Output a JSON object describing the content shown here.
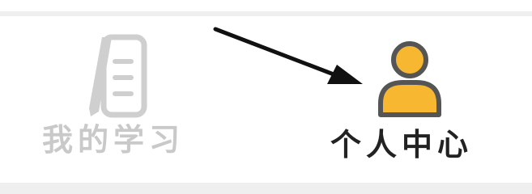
{
  "tabbar": {
    "tabs": [
      {
        "label": "我的学习",
        "icon": "document-pencil-icon",
        "state": "inactive"
      },
      {
        "label": "个人中心",
        "icon": "user-icon",
        "state": "active"
      }
    ]
  },
  "colors": {
    "inactive": "#c9c9c9",
    "active_text": "#222222",
    "active_icon_fill": "#f7b731",
    "active_icon_stroke": "#555555",
    "arrow": "#111111"
  }
}
